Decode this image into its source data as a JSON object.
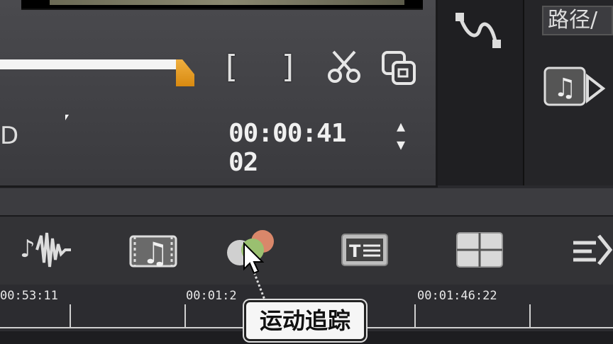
{
  "preview": {
    "left_fragment": "D",
    "timecode": "00:00:41 02",
    "buttons": {
      "mark_in": "[",
      "mark_out": "]"
    }
  },
  "side_panel": {
    "label": "路径/",
    "icon_label": "▶"
  },
  "toolbar": {
    "items": [
      {
        "icon": "audio-waveform-icon"
      },
      {
        "icon": "music-note-icon"
      },
      {
        "icon": "motion-balloons-icon"
      },
      {
        "icon": "title-icon"
      },
      {
        "icon": "overlay-grid-icon"
      },
      {
        "icon": "transition-icon"
      }
    ]
  },
  "ruler": {
    "labels": [
      "00:53:11",
      "00:01:2",
      "00:01:46:22"
    ]
  },
  "tooltip": {
    "text": "运动追踪"
  },
  "colors": {
    "scrub_handle": "#e8a020",
    "panel_bg": "#3a3a3e",
    "tooltip_bg": "#f6f6f6"
  }
}
